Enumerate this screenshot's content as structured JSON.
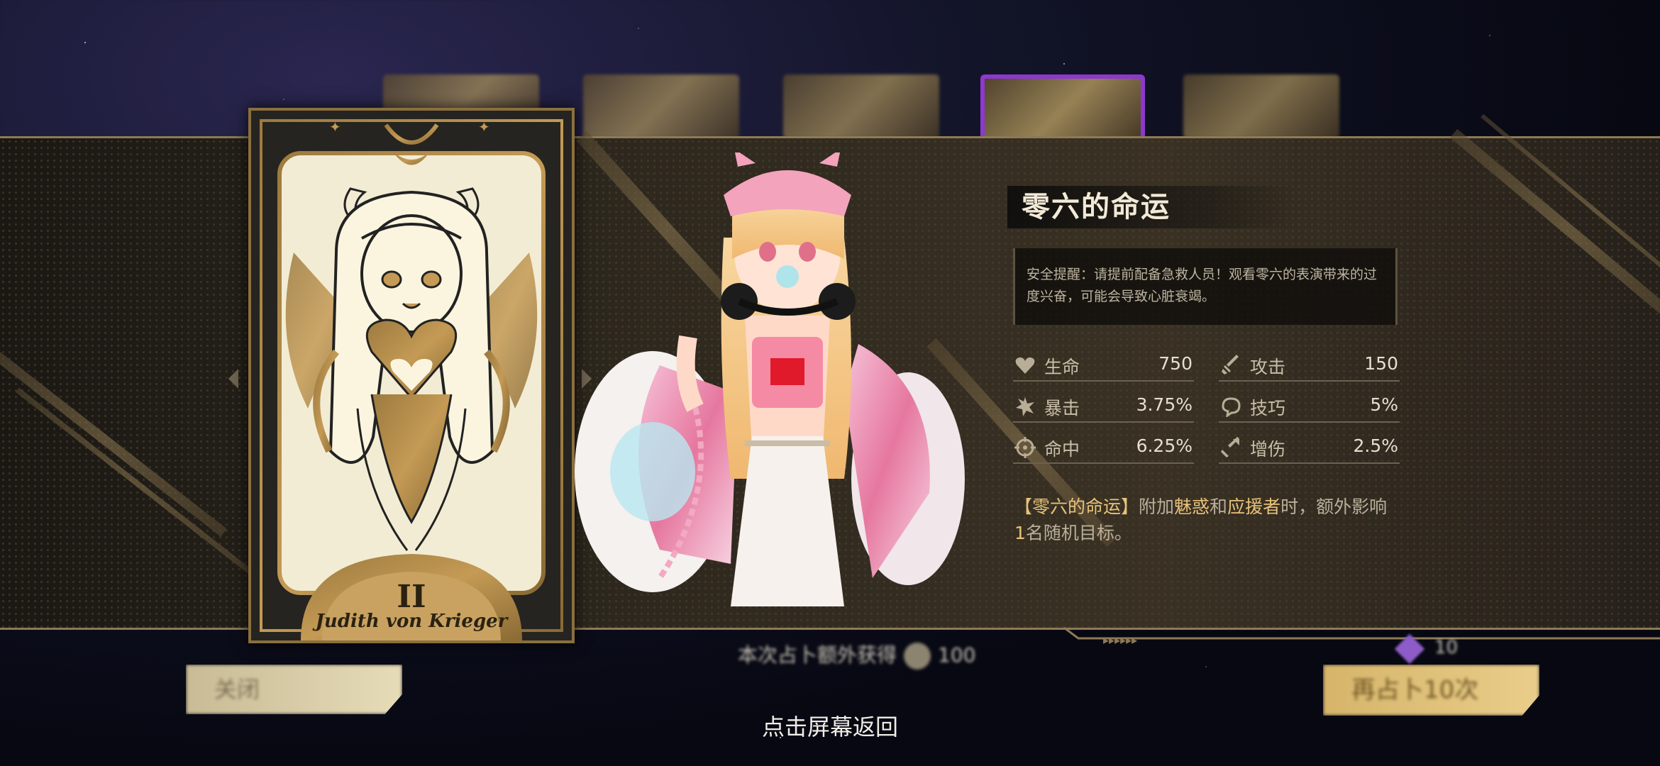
{
  "card": {
    "numeral": "II",
    "name": "Judith von Krieger"
  },
  "skill": {
    "title": "零六的命运",
    "warning": "安全提醒：请提前配备急救人员！观看零六的表演带来的过度兴奋，可能会导致心脏衰竭。",
    "description": {
      "part1": "【零六的命运】",
      "part2": "附加",
      "part3": "魅惑",
      "part4": "和",
      "part5": "应援者",
      "part6": "时，额外影响",
      "part7": "1",
      "part8": "名随机目标。"
    }
  },
  "stats": [
    {
      "label": "生命",
      "value": "750",
      "icon": "heart-icon"
    },
    {
      "label": "攻击",
      "value": "150",
      "icon": "sword-icon"
    },
    {
      "label": "暴击",
      "value": "3.75%",
      "icon": "burst-icon"
    },
    {
      "label": "技巧",
      "value": "5%",
      "icon": "swirl-icon"
    },
    {
      "label": "命中",
      "value": "6.25%",
      "icon": "crosshair-icon"
    },
    {
      "label": "增伤",
      "value": "2.5%",
      "icon": "damage-up-icon"
    }
  ],
  "bottom": {
    "extra_reward_label": "本次占卜额外获得",
    "extra_reward_value": "100",
    "gem_count": "10",
    "close_label": "关闭",
    "again_label": "再占卜10次",
    "return_hint": "点击屏幕返回"
  },
  "colors": {
    "gold": "#b08a4a",
    "highlight": "#e8c37a",
    "selected_border": "#9b3de0"
  }
}
